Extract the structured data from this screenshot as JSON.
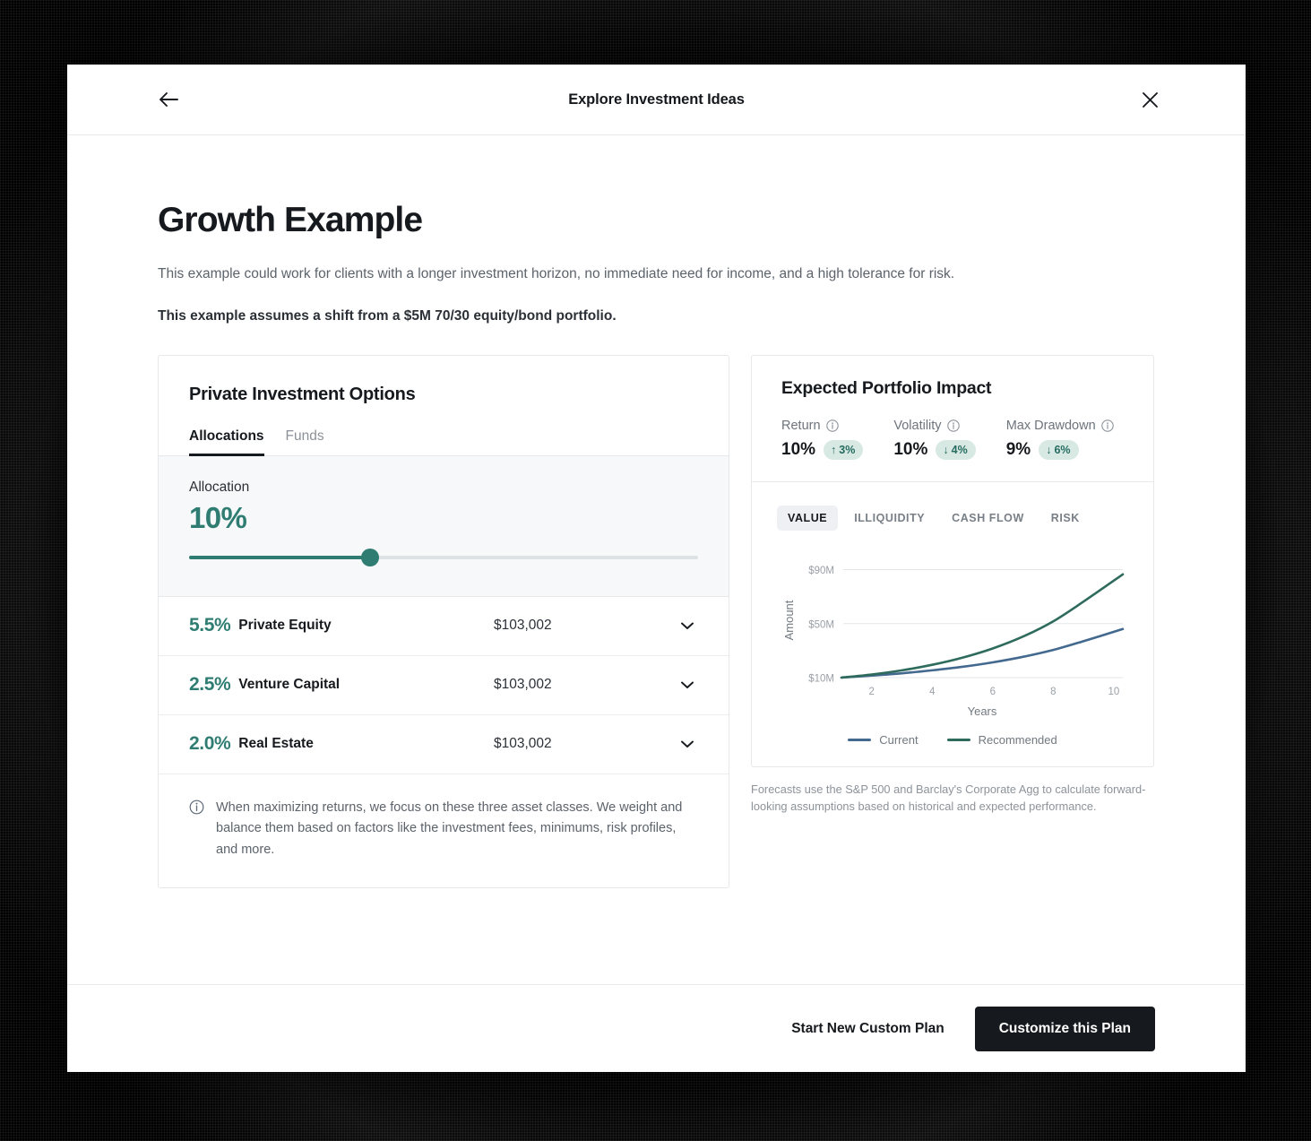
{
  "header": {
    "back_icon": "arrow-left-icon",
    "title": "Explore Investment Ideas",
    "close_icon": "close-icon"
  },
  "page": {
    "title": "Growth Example",
    "subtitle": "This example could work for clients with a longer investment horizon, no immediate need for income, and a high tolerance for risk.",
    "assumption": "This example assumes a shift from a $5M 70/30 equity/bond portfolio."
  },
  "left_card": {
    "title": "Private Investment Options",
    "tabs": [
      {
        "label": "Allocations",
        "active": true
      },
      {
        "label": "Funds",
        "active": false
      }
    ],
    "allocation": {
      "label": "Allocation",
      "value": "10%",
      "slider_percent": 35.5
    },
    "assets": [
      {
        "pct": "5.5%",
        "name": "Private Equity",
        "amount": "$103,002",
        "chevron": "chevron-down-icon"
      },
      {
        "pct": "2.5%",
        "name": "Venture Capital",
        "amount": "$103,002",
        "chevron": "chevron-down-icon"
      },
      {
        "pct": "2.0%",
        "name": "Real Estate",
        "amount": "$103,002",
        "chevron": "chevron-down-icon"
      }
    ],
    "note": {
      "icon": "info-icon",
      "text": "When maximizing returns, we focus on these three asset classes. We weight and balance them based on factors like the investment fees, minimums, risk profiles, and more."
    }
  },
  "right_card": {
    "title": "Expected Portfolio Impact",
    "metrics": [
      {
        "label": "Return",
        "info_icon": "info-circle-icon",
        "value": "10%",
        "badge": "3%",
        "badge_direction": "up",
        "badge_arrow": "↑"
      },
      {
        "label": "Volatility",
        "info_icon": "info-circle-icon",
        "value": "10%",
        "badge": "4%",
        "badge_direction": "down",
        "badge_arrow": "↓"
      },
      {
        "label": "Max Drawdown",
        "info_icon": "info-circle-icon",
        "value": "9%",
        "badge": "6%",
        "badge_direction": "down",
        "badge_arrow": "↓"
      }
    ],
    "chart_tabs": [
      {
        "label": "VALUE",
        "active": true
      },
      {
        "label": "ILLIQUIDITY",
        "active": false
      },
      {
        "label": "CASH FLOW",
        "active": false
      },
      {
        "label": "RISK",
        "active": false
      }
    ],
    "forecast_note": "Forecasts use the S&P 500 and Barclay's Corporate Agg to calculate forward-looking assumptions based on historical and expected performance."
  },
  "chart_data": {
    "type": "line",
    "title": "",
    "xlabel": "Years",
    "ylabel": "Amount",
    "x": [
      1,
      2,
      3,
      4,
      5,
      6,
      7,
      8,
      9,
      10.3
    ],
    "xlim": [
      1,
      10.3
    ],
    "ylim": [
      10,
      95
    ],
    "xticks": [
      2,
      4,
      6,
      8,
      10
    ],
    "xtick_labels": [
      "2",
      "4",
      "6",
      "8",
      "10"
    ],
    "yticks": [
      10,
      50,
      90
    ],
    "ytick_labels": [
      "$10M",
      "$50M",
      "$90M"
    ],
    "grid": true,
    "legend_position": "bottom",
    "series": [
      {
        "name": "Current",
        "color": "#43698f",
        "values": [
          10.0,
          11.5,
          13.2,
          15.4,
          18.0,
          21.3,
          25.4,
          30.5,
          37.0,
          46.0
        ]
      },
      {
        "name": "Recommended",
        "color": "#2e6b5c",
        "values": [
          10.0,
          12.3,
          15.4,
          19.5,
          24.8,
          31.6,
          40.4,
          51.7,
          66.3,
          86.5
        ]
      }
    ]
  },
  "footer": {
    "secondary_label": "Start New Custom Plan",
    "primary_label": "Customize this Plan"
  },
  "colors": {
    "accent_teal": "#2f7d72",
    "badge_bg": "#d8e9e4",
    "badge_text": "#256b5f",
    "line_current": "#43698f",
    "line_recommended": "#2e6b5c",
    "ink": "#16191d",
    "muted": "#6d747c"
  }
}
